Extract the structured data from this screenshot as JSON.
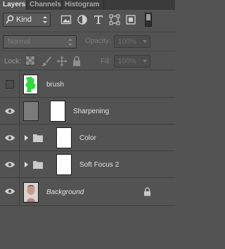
{
  "tabs": [
    {
      "label": "Layers",
      "active": true
    },
    {
      "label": "Channels",
      "active": false
    },
    {
      "label": "Histogram",
      "active": false
    }
  ],
  "filter": {
    "kind_label": "Kind",
    "icons": [
      "pixel-filter-icon",
      "adjustment-filter-icon",
      "type-filter-icon",
      "shape-filter-icon",
      "smart-object-filter-icon"
    ]
  },
  "blend": {
    "mode": "Normal",
    "opacity_label": "Opacity:",
    "opacity_value": "100%"
  },
  "lock": {
    "label": "Lock:",
    "fill_label": "Fill:",
    "fill_value": "100%"
  },
  "layers": [
    {
      "name": "brush",
      "visible": false,
      "kind": "layer-with-mask"
    },
    {
      "name": "Sharpening",
      "visible": true,
      "kind": "layer-with-mask"
    },
    {
      "name": "Color",
      "visible": true,
      "kind": "group"
    },
    {
      "name": "Soft Focus 2",
      "visible": true,
      "kind": "group"
    },
    {
      "name": "Background",
      "visible": true,
      "kind": "background",
      "locked": true
    }
  ],
  "colors": {
    "panel_bg": "#535353",
    "mask_green": "#2ddc3c",
    "text": "#e2e2e2"
  }
}
